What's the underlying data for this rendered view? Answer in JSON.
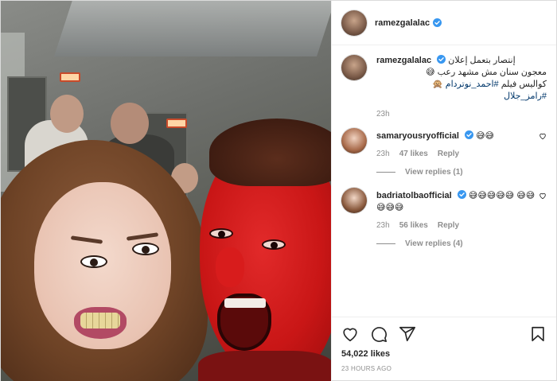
{
  "post": {
    "author": "ramezgalalac",
    "caption_line1": "إنتصار بتعمل إعلان",
    "caption_line2": "معجون سنان مش مشهد رعب 😅",
    "caption_line3": "كواليس فيلم ",
    "hashtag1": "#احمد_نوتردام",
    "hashtag_emoji": " 🙊",
    "hashtag2": "#رامز_جلال",
    "caption_time": "23h",
    "likes": "54,022 likes",
    "posted_ago": "23 HOURS AGO"
  },
  "comments": [
    {
      "username": "samaryousryofficial",
      "text": " 😅😅",
      "time": "23h",
      "likes": "47 likes",
      "reply_label": "Reply",
      "view_replies": "View replies (1)"
    },
    {
      "username": "badriatolbaofficial",
      "text": " 😅😅😅😅😅 😅😅😅😅😅",
      "time": "23h",
      "likes": "56 likes",
      "reply_label": "Reply",
      "view_replies": "View replies (4)"
    }
  ],
  "colors": {
    "verified_blue": "#3897f0",
    "hashtag": "#00376b",
    "muted": "#8e8e8e"
  },
  "icons": [
    "verified-icon",
    "heart-icon",
    "comment-icon",
    "share-icon",
    "save-icon"
  ]
}
